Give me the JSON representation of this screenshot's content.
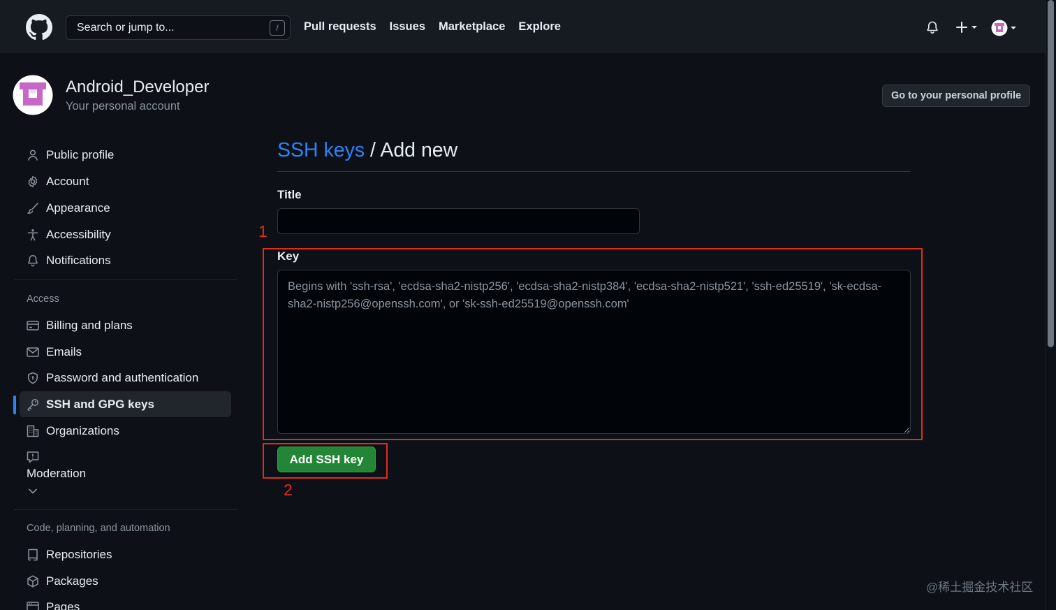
{
  "header": {
    "search_placeholder": "Search or jump to...",
    "search_shortcut": "/",
    "nav": [
      "Pull requests",
      "Issues",
      "Marketplace",
      "Explore"
    ]
  },
  "account": {
    "username": "Android_Developer",
    "subtitle": "Your personal account",
    "profile_button": "Go to your personal profile"
  },
  "sidebar": {
    "items_top": [
      {
        "label": "Public profile",
        "icon": "person-icon"
      },
      {
        "label": "Account",
        "icon": "gear-icon"
      },
      {
        "label": "Appearance",
        "icon": "paintbrush-icon"
      },
      {
        "label": "Accessibility",
        "icon": "accessibility-icon"
      },
      {
        "label": "Notifications",
        "icon": "bell-icon"
      }
    ],
    "access_heading": "Access",
    "items_access": [
      {
        "label": "Billing and plans",
        "icon": "credit-card-icon"
      },
      {
        "label": "Emails",
        "icon": "mail-icon"
      },
      {
        "label": "Password and authentication",
        "icon": "shield-icon"
      },
      {
        "label": "SSH and GPG keys",
        "icon": "key-icon",
        "active": true
      },
      {
        "label": "Organizations",
        "icon": "organization-icon"
      }
    ],
    "moderation": "Moderation",
    "code_heading": "Code, planning, and automation",
    "items_code": [
      {
        "label": "Repositories",
        "icon": "repo-icon"
      },
      {
        "label": "Packages",
        "icon": "package-icon"
      },
      {
        "label": "Pages",
        "icon": "browser-icon"
      }
    ]
  },
  "main": {
    "breadcrumb_link": "SSH keys",
    "breadcrumb_sep": " / ",
    "breadcrumb_current": "Add new",
    "title_label": "Title",
    "title_value": "",
    "key_label": "Key",
    "key_placeholder": "Begins with 'ssh-rsa', 'ecdsa-sha2-nistp256', 'ecdsa-sha2-nistp384', 'ecdsa-sha2-nistp521', 'ssh-ed25519', 'sk-ecdsa-sha2-nistp256@openssh.com', or 'sk-ssh-ed25519@openssh.com'",
    "add_button": "Add SSH key"
  },
  "annotations": {
    "marker_1": "1",
    "marker_2": "2",
    "color": "#e02c1f"
  },
  "watermark": "@稀土掘金技术社区",
  "colors": {
    "accent": "#2f81f7",
    "primary_button": "#238636",
    "background": "#0d1117",
    "header": "#161b22"
  }
}
